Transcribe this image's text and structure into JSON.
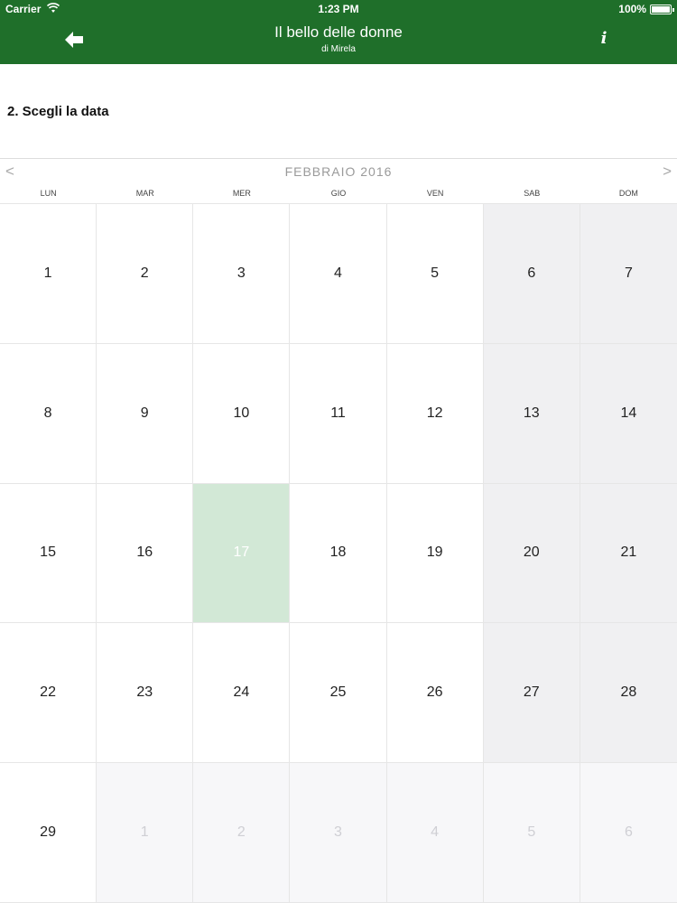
{
  "status_bar": {
    "carrier": "Carrier",
    "time": "1:23 PM",
    "battery": "100%",
    "battery_level": 1.0
  },
  "nav": {
    "back_icon": "arrow-left-icon",
    "title": "Il bello delle donne",
    "subtitle": "di Mirela",
    "info_icon": "info-icon",
    "info_glyph": "i"
  },
  "step": {
    "title": "2. Scegli la data"
  },
  "calendar": {
    "prev_label": "<",
    "next_label": ">",
    "month": "FEBBRAIO 2016",
    "weekdays": [
      "LUN",
      "MAR",
      "MER",
      "GIO",
      "VEN",
      "SAB",
      "DOM"
    ],
    "days": [
      {
        "label": "1",
        "state": "normal"
      },
      {
        "label": "2",
        "state": "normal"
      },
      {
        "label": "3",
        "state": "normal"
      },
      {
        "label": "4",
        "state": "normal"
      },
      {
        "label": "5",
        "state": "normal"
      },
      {
        "label": "6",
        "state": "weekend"
      },
      {
        "label": "7",
        "state": "weekend"
      },
      {
        "label": "8",
        "state": "normal"
      },
      {
        "label": "9",
        "state": "normal"
      },
      {
        "label": "10",
        "state": "normal"
      },
      {
        "label": "11",
        "state": "normal"
      },
      {
        "label": "12",
        "state": "normal"
      },
      {
        "label": "13",
        "state": "weekend"
      },
      {
        "label": "14",
        "state": "weekend"
      },
      {
        "label": "15",
        "state": "normal"
      },
      {
        "label": "16",
        "state": "normal"
      },
      {
        "label": "17",
        "state": "selected"
      },
      {
        "label": "18",
        "state": "normal"
      },
      {
        "label": "19",
        "state": "normal"
      },
      {
        "label": "20",
        "state": "weekend"
      },
      {
        "label": "21",
        "state": "weekend"
      },
      {
        "label": "22",
        "state": "normal"
      },
      {
        "label": "23",
        "state": "normal"
      },
      {
        "label": "24",
        "state": "normal"
      },
      {
        "label": "25",
        "state": "normal"
      },
      {
        "label": "26",
        "state": "normal"
      },
      {
        "label": "27",
        "state": "weekend"
      },
      {
        "label": "28",
        "state": "weekend"
      },
      {
        "label": "29",
        "state": "normal"
      },
      {
        "label": "1",
        "state": "other"
      },
      {
        "label": "2",
        "state": "other"
      },
      {
        "label": "3",
        "state": "other"
      },
      {
        "label": "4",
        "state": "other"
      },
      {
        "label": "5",
        "state": "other"
      },
      {
        "label": "6",
        "state": "other"
      }
    ]
  },
  "colors": {
    "bar": "#1f6f2a",
    "selected": "#d2e8d6",
    "weekend": "#f0f0f2"
  }
}
